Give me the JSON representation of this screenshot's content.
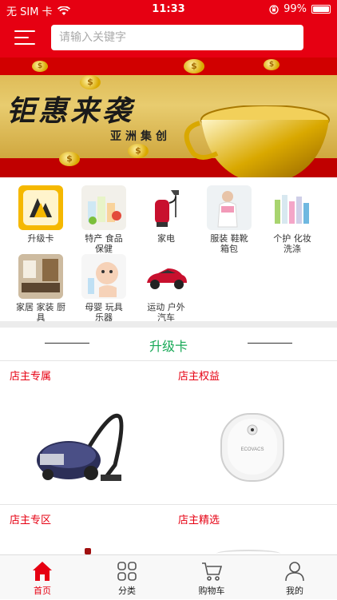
{
  "status_bar": {
    "carrier": "无 SIM 卡",
    "time": "11:33",
    "battery": "99%"
  },
  "header": {
    "search_placeholder": "请输入关键字"
  },
  "banner": {
    "title": "钜惠来袭",
    "subtitle": "亚洲集创",
    "slide_count": 2,
    "active_slide": 2
  },
  "categories": [
    {
      "label": "升级卡",
      "icon": "upgrade-card-icon"
    },
    {
      "label": "特产 食品\n保健",
      "icon": "food-icon"
    },
    {
      "label": "家电",
      "icon": "appliance-icon"
    },
    {
      "label": "服装  鞋靴\n箱包",
      "icon": "clothing-icon"
    },
    {
      "label": "个护 化妆\n洗涤",
      "icon": "cosmetics-icon"
    },
    {
      "label": "家居 家装 厨\n具",
      "icon": "home-icon"
    },
    {
      "label": "母婴 玩具\n乐器",
      "icon": "baby-icon"
    },
    {
      "label": "运动 户外\n汽车",
      "icon": "car-icon"
    }
  ],
  "section": {
    "title": "升级卡"
  },
  "products": [
    {
      "title": "店主专属"
    },
    {
      "title": "店主权益"
    },
    {
      "title": "店主专区"
    },
    {
      "title": "店主精选"
    }
  ],
  "tabbar": {
    "items": [
      {
        "label": "首页",
        "icon": "home-icon",
        "active": true
      },
      {
        "label": "分类",
        "icon": "category-icon",
        "active": false
      },
      {
        "label": "购物车",
        "icon": "cart-icon",
        "active": false
      },
      {
        "label": "我的",
        "icon": "profile-icon",
        "active": false
      }
    ]
  },
  "colors": {
    "brand": "#e60012",
    "section_title": "#18a957"
  }
}
